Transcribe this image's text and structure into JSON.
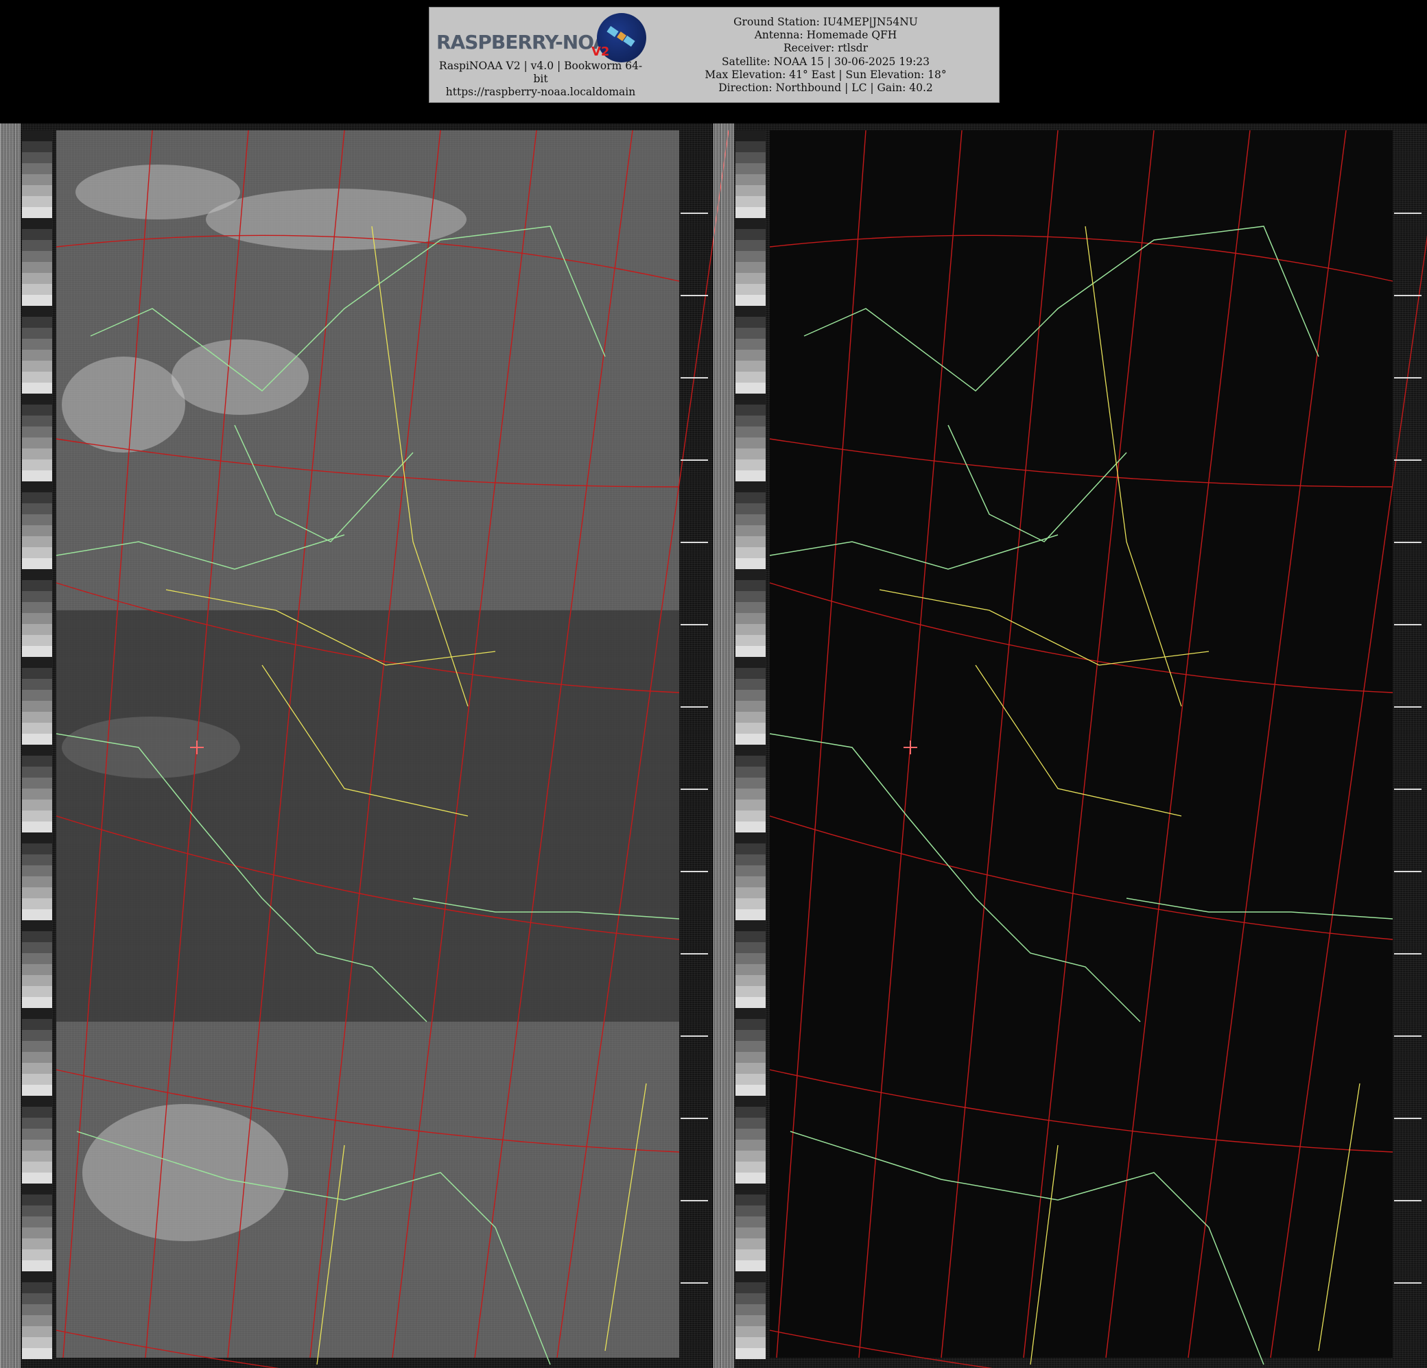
{
  "header": {
    "logo_text": "RASPBERRY-NOAA",
    "logo_version": "V2",
    "left_lines": [
      "RaspiNOAA V2 | v4.0 | Bookworm 64-",
      "bit",
      "https://raspberry-noaa.localdomain"
    ],
    "right_lines": [
      "Ground Station: IU4MEP|JN54NU",
      "Antenna: Homemade QFH",
      "Receiver: rtlsdr",
      "Satellite: NOAA 15 | 30-06-2025 19:23",
      "Max Elevation: 41° East | Sun Elevation: 18°",
      "Direction: Northbound | LC | Gain: 40.2"
    ]
  },
  "panels": [
    {
      "channel": "visible",
      "tint": "#9a9a9a"
    },
    {
      "channel": "infrared",
      "tint": "#0a0a0a"
    }
  ],
  "colors": {
    "coastline": "#9be39b",
    "border": "#e8e25a",
    "graticule": "#c41a1a",
    "station_marker": "#ff6a6a"
  }
}
